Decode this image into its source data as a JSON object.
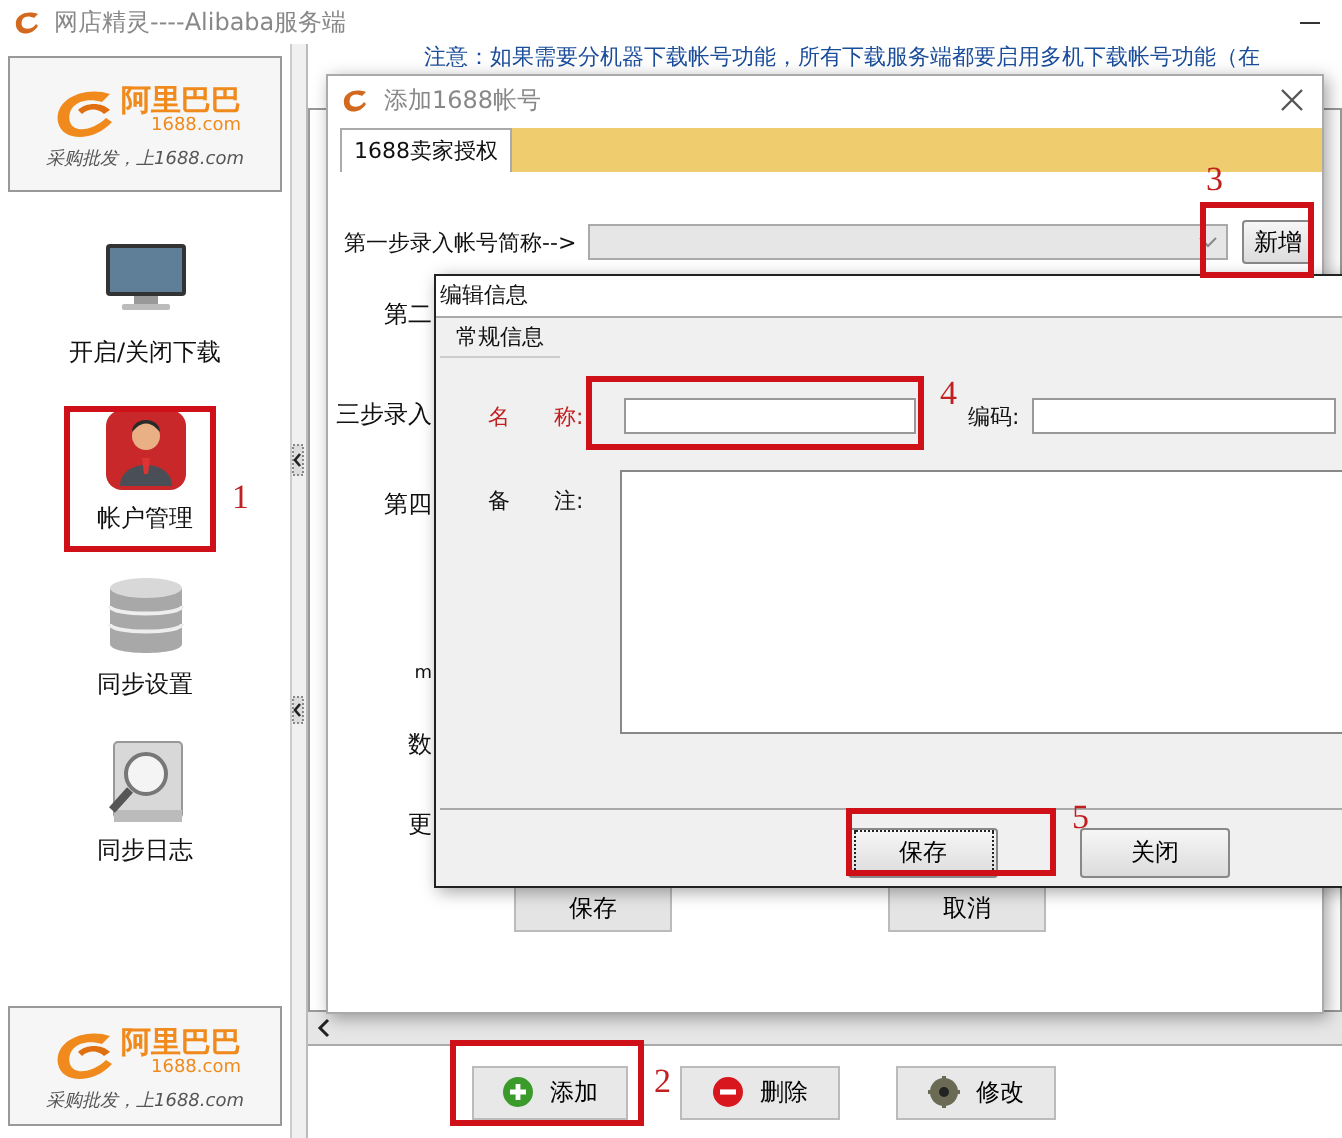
{
  "app": {
    "title": "网店精灵----Alibaba服务端"
  },
  "logos": [
    {
      "brand": "阿里巴巴",
      "domain": "1688.com",
      "slogan": "采购批发，上1688.com"
    },
    {
      "brand": "阿里巴巴",
      "domain": "1688.com",
      "slogan": "采购批发，上1688.com"
    }
  ],
  "sidebar": {
    "items": [
      {
        "label": "开启/关闭下载",
        "kind": "monitor"
      },
      {
        "label": "帐户管理",
        "kind": "person"
      },
      {
        "label": "同步设置",
        "kind": "database"
      },
      {
        "label": "同步日志",
        "kind": "log"
      }
    ]
  },
  "notice": "注意：如果需要分机器下载帐号功能，所有下载服务端都要启用多机下载帐号功能（在",
  "toolbar": {
    "buttons": [
      {
        "label": "添加",
        "kind": "add"
      },
      {
        "label": "删除",
        "kind": "delete"
      },
      {
        "label": "修改",
        "kind": "edit"
      }
    ]
  },
  "add_dialog": {
    "title": "添加1688帐号",
    "tabs": [
      {
        "label": "1688卖家授权",
        "selected": true
      }
    ],
    "step_label": "第一步录入帐号简称-->",
    "new_button": "新增",
    "partial_labels": [
      "第二",
      "三步录入",
      "第四",
      "m",
      "数",
      "更"
    ],
    "buttons": [
      "保存",
      "取消"
    ]
  },
  "edit_dialog": {
    "title": "编辑信息",
    "group": "常规信息",
    "fields": [
      {
        "label": "名　　称:",
        "required": true,
        "kind": "line"
      },
      {
        "label": "编码:",
        "required": false,
        "kind": "line"
      },
      {
        "label": "备　　注:",
        "required": false,
        "kind": "area"
      }
    ],
    "buttons": [
      {
        "label": "保存",
        "focused": true
      },
      {
        "label": "关闭",
        "focused": false
      }
    ]
  },
  "annotations": [
    {
      "number": "1"
    },
    {
      "number": "2"
    },
    {
      "number": "3"
    },
    {
      "number": "4"
    },
    {
      "number": "5"
    }
  ]
}
